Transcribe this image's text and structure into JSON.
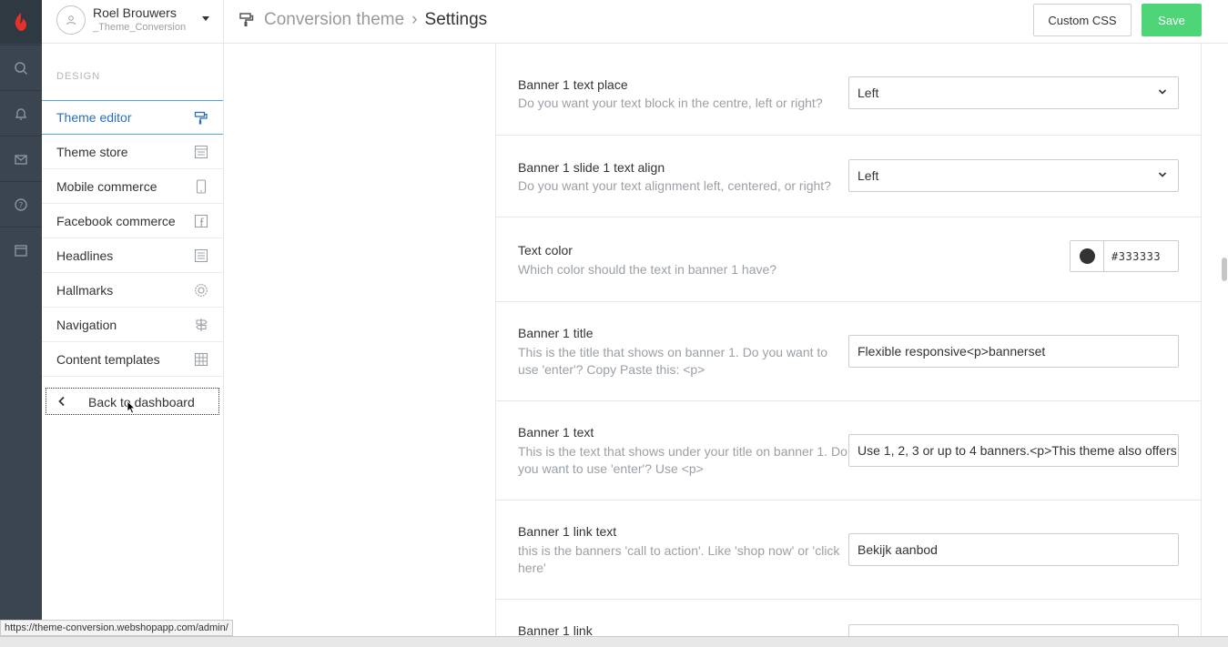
{
  "header": {
    "user_name": "Roel Brouwers",
    "store_name": "_Theme_Conversion",
    "breadcrumb_parent": "Conversion theme",
    "breadcrumb_separator": "›",
    "breadcrumb_current": "Settings",
    "custom_css_label": "Custom CSS",
    "save_label": "Save"
  },
  "sidebar": {
    "section_title": "DESIGN",
    "items": [
      {
        "label": "Theme editor",
        "icon": "paint-roller-icon",
        "active": true
      },
      {
        "label": "Theme store",
        "icon": "store-grid-icon"
      },
      {
        "label": "Mobile commerce",
        "icon": "mobile-icon"
      },
      {
        "label": "Facebook commerce",
        "icon": "facebook-icon"
      },
      {
        "label": "Headlines",
        "icon": "headlines-icon"
      },
      {
        "label": "Hallmarks",
        "icon": "hallmark-badge-icon"
      },
      {
        "label": "Navigation",
        "icon": "signpost-icon"
      },
      {
        "label": "Content templates",
        "icon": "template-grid-icon"
      }
    ],
    "back_label": "Back to dashboard"
  },
  "rail": {
    "icons": [
      "logo-icon",
      "search-icon",
      "bell-icon",
      "mail-icon",
      "help-icon",
      "window-icon"
    ]
  },
  "settings": [
    {
      "label": "Banner 1 text place",
      "description": "Do you want your text block in the centre, left or right?",
      "type": "select",
      "value": "Left"
    },
    {
      "label": "Banner 1 slide 1 text align",
      "description": "Do you want your text alignment left, centered, or right?",
      "type": "select",
      "value": "Left"
    },
    {
      "label": "Text color",
      "description": "Which color should the text in banner 1 have?",
      "type": "color",
      "value": "#333333"
    },
    {
      "label": "Banner 1 title",
      "description": "This is the title that shows on banner 1. Do you want to use 'enter'? Copy Paste this: <p>",
      "type": "text",
      "value": "Flexible responsive<p>bannerset"
    },
    {
      "label": "Banner 1 text",
      "description": "This is the text that shows under your title on banner 1. Do you want to use 'enter'? Use <p>",
      "type": "text",
      "value": "Use 1, 2, 3 or up to 4 banners.<p>This theme also offers"
    },
    {
      "label": "Banner 1 link text",
      "description": "this is the banners 'call to action'. Like 'shop now' or 'click here'",
      "type": "text",
      "value": "Bekijk aanbod"
    },
    {
      "label": "Banner 1 link",
      "description": "",
      "type": "text",
      "value": ""
    }
  ],
  "status_url": "https://theme-conversion.webshopapp.com/admin/",
  "colors": {
    "rail": "#3a4550",
    "accent": "#2a6ebb",
    "save": "#4ed577",
    "logo": "#e4312b"
  }
}
